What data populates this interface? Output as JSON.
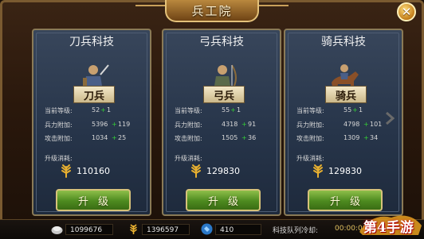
{
  "window": {
    "title": "兵工院",
    "close_symbol": "✕"
  },
  "cards": [
    {
      "title": "刀兵科技",
      "unit": "刀兵",
      "level_label": "当前等级:",
      "level": "52",
      "level_inc": "1",
      "hp_label": "兵力附加:",
      "hp": "5396",
      "hp_inc": "119",
      "atk_label": "攻击附加:",
      "atk": "1034",
      "atk_inc": "25",
      "cost_label": "升级消耗:",
      "cost": "110160",
      "button": "升级"
    },
    {
      "title": "弓兵科技",
      "unit": "弓兵",
      "level_label": "当前等级:",
      "level": "55",
      "level_inc": "1",
      "hp_label": "兵力附加:",
      "hp": "4318",
      "hp_inc": "91",
      "atk_label": "攻击附加:",
      "atk": "1505",
      "atk_inc": "36",
      "cost_label": "升级消耗:",
      "cost": "129830",
      "button": "升级"
    },
    {
      "title": "骑兵科技",
      "unit": "骑兵",
      "level_label": "当前等级:",
      "level": "55",
      "level_inc": "1",
      "hp_label": "兵力附加:",
      "hp": "4798",
      "hp_inc": "101",
      "atk_label": "攻击附加:",
      "atk": "1309",
      "atk_inc": "34",
      "cost_label": "升级消耗:",
      "cost": "129830",
      "button": "升级"
    }
  ],
  "plus_sign": "+",
  "resources": {
    "silver": "1099676",
    "grain": "1396597",
    "gems": "410"
  },
  "cooldown_label": "科技队列冷却:",
  "cooldown_value": "00:00:00",
  "watermark": "第4手游",
  "colors": {
    "increase": "#34d034",
    "button_green": "#4d8a1f",
    "frame_gold": "#8a7a56"
  }
}
